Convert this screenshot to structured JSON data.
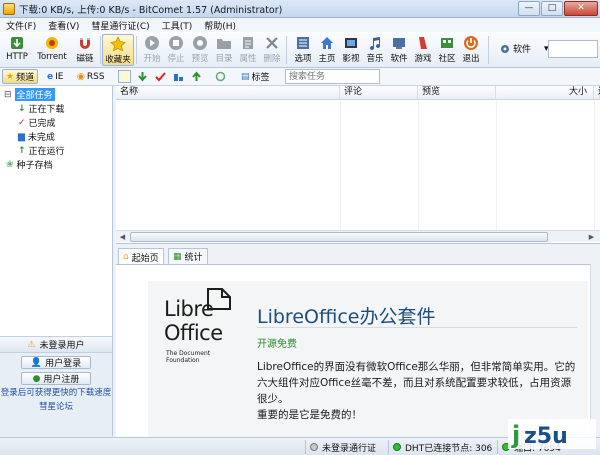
{
  "window": {
    "title": "下载:0 KB/s, 上传:0 KB/s - BitComet 1.57 (Administrator)",
    "min": "—",
    "max": "□",
    "close": "✕"
  },
  "menu": [
    "文件(F)",
    "查看(V)",
    "彗星通行证(C)",
    "工具(T)",
    "帮助(H)"
  ],
  "toolbar": {
    "http": "HTTP",
    "torrent": "Torrent",
    "magnet": "磁链",
    "favorites": "收藏夹",
    "start": "开始",
    "stop": "停止",
    "preview": "预览",
    "directory": "目录",
    "properties": "属性",
    "delete": "删除",
    "options": "选项",
    "home": "主页",
    "video": "影视",
    "music": "音乐",
    "software": "软件",
    "games": "游戏",
    "community": "社区",
    "exit": "退出",
    "software_dropdown": "软件"
  },
  "toolbar2": {
    "channels": "频道",
    "ie": "IE",
    "rss": "RSS",
    "tags": "标签",
    "search_placeholder": "搜索任务"
  },
  "tree": {
    "all": "全部任务",
    "downloading": "正在下载",
    "completed": "已完成",
    "incomplete": "未完成",
    "running": "正在运行",
    "seed_archive": "种子存档"
  },
  "user": {
    "header": "未登录用户",
    "login": "用户登录",
    "register": "用户注册",
    "link1": "登录后可获得更快的下载速度",
    "link2": "彗星论坛"
  },
  "columns": [
    "名称",
    "评论",
    "预览",
    "大小",
    "进"
  ],
  "bottom_tabs": [
    "起始页",
    "统计"
  ],
  "content": {
    "logo_line1": "Libre",
    "logo_line2": "Office",
    "logo_sub": "The Document Foundation",
    "title": "LibreOffice办公套件",
    "subtitle": "开源免费",
    "body": "LibreOffice的界面没有微软Office那么华丽，但非常简单实用。它的六大组件对应Office丝毫不差，而且对系统配置要求较低，占用资源很少。\n重要的是它是免费的！"
  },
  "status": {
    "passport": "未登录通行证",
    "dht": "DHT已连接节点: 306",
    "port": "端口: 7694"
  },
  "watermark": "jz5u",
  "colors": {
    "accent": "#3399ff",
    "title_blue": "#1b4e7a",
    "green": "#2b8a2b"
  }
}
